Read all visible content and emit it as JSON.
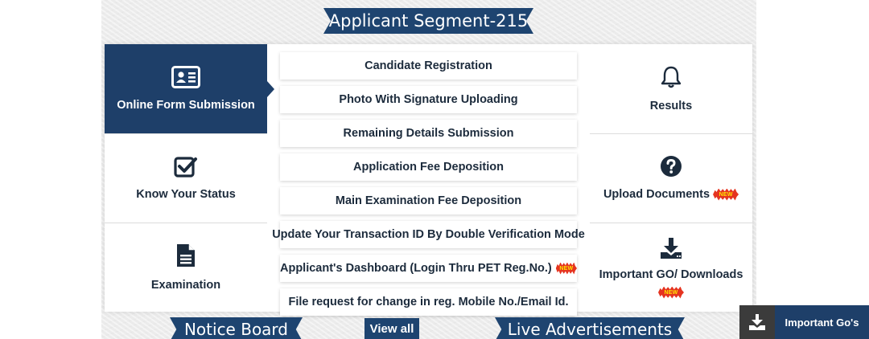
{
  "banner": {
    "title": "Applicant Segment-215"
  },
  "left_tiles": [
    {
      "label": "Online Form Submission",
      "icon": "id-card-icon",
      "active": true
    },
    {
      "label": "Know Your Status",
      "icon": "checkbox-icon"
    },
    {
      "label": "Examination",
      "icon": "document-icon"
    }
  ],
  "links": [
    {
      "label": "Candidate Registration"
    },
    {
      "label": "Photo With Signature Uploading"
    },
    {
      "label": "Remaining Details Submission"
    },
    {
      "label": "Application Fee Deposition"
    },
    {
      "label": "Main Examination Fee Deposition"
    },
    {
      "label": "Update Your Transaction ID By Double Verification Mode"
    },
    {
      "label": "Applicant's Dashboard (Login Thru PET Reg.No.)",
      "badge": "NEW"
    },
    {
      "label": "File request for change in reg. Mobile No./Email Id."
    }
  ],
  "right_tiles": [
    {
      "label": "Results",
      "icon": "bell-icon"
    },
    {
      "label": "Upload Documents",
      "icon": "question-circle-icon",
      "badge": "NEW"
    },
    {
      "label": "Important GO/ Downloads",
      "icon": "download-icon",
      "badge": "NEW"
    }
  ],
  "bottom": {
    "notice_board": "Notice Board",
    "view_all": "View all",
    "live_ads": "Live Advertisements"
  },
  "floating": {
    "label": "Important Go's",
    "icon": "download-tray-icon"
  },
  "colors": {
    "navy": "#1e3f69",
    "ribbon": "#1e4470",
    "badge_red": "#e53420",
    "badge_text": "#ffe600"
  }
}
